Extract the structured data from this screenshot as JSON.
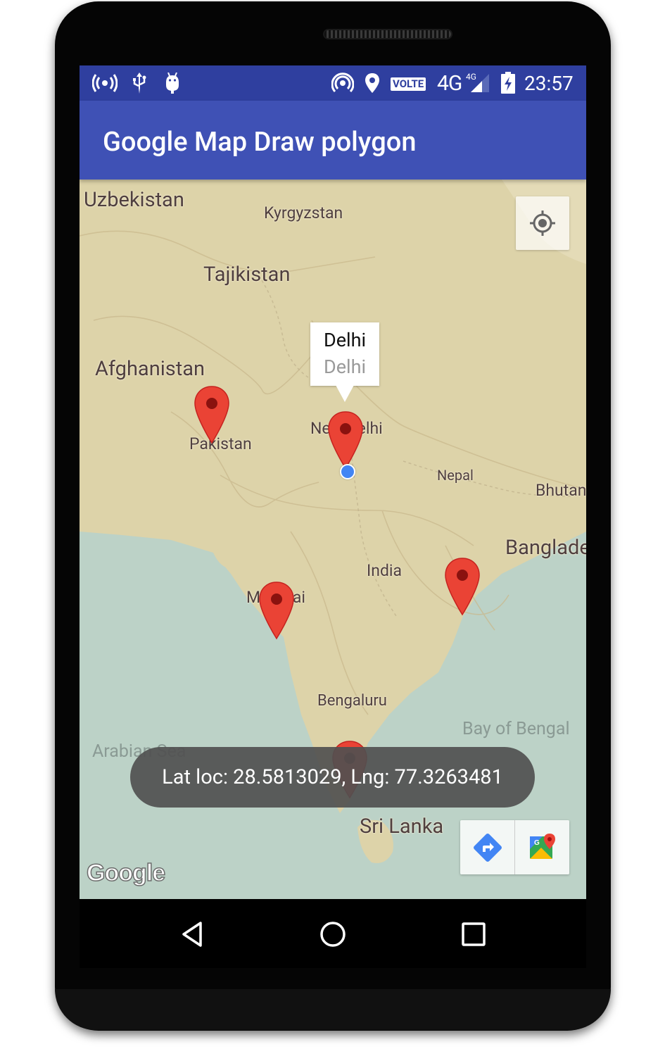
{
  "status_bar": {
    "time": "23:57",
    "volte": "VOLTE",
    "network": "4G",
    "network_sup": "4G",
    "icons": [
      "hotspot-icon",
      "usb-icon",
      "android-debug-icon",
      "nfc-icon",
      "location-icon",
      "signal-icon",
      "battery-charging-icon"
    ]
  },
  "app_bar": {
    "title": "Google Map Draw polygon"
  },
  "map": {
    "labels": {
      "uzbekistan": "Uzbekistan",
      "kyrgyzstan": "Kyrgyzstan",
      "tajikistan": "Tajikistan",
      "afghanistan": "Afghanistan",
      "pakistan": "Pakistan",
      "new_delhi": "New Delhi",
      "nepal": "Nepal",
      "bhutan": "Bhutan",
      "bangladesh": "Banglade",
      "india": "India",
      "mumbai": "Mumbai",
      "bengaluru": "Bengaluru",
      "bay_of_bengal": "Bay of Bengal",
      "arabian_sea": "Arabian Sea",
      "sri_lanka": "Sri Lanka"
    },
    "info_window": {
      "title": "Delhi",
      "snippet": "Delhi"
    },
    "google_logo": "Google",
    "colors": {
      "land": "#ddd3a9",
      "water": "#bcd2c7",
      "marker": "#ea4335",
      "my_location": "#4285f4"
    }
  },
  "toast": {
    "text": "Lat loc: 28.5813029, Lng: 77.3263481"
  },
  "nav_bar": {
    "icons": [
      "back-icon",
      "home-icon",
      "recents-icon"
    ]
  }
}
